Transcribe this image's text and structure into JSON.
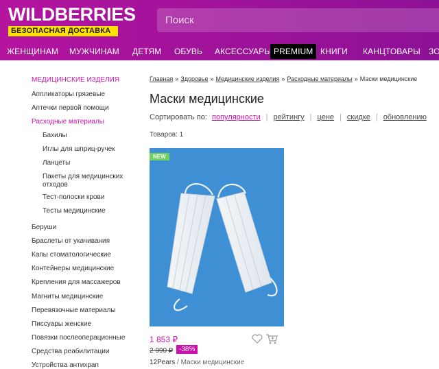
{
  "header": {
    "logo": "WILDBERRIES",
    "logo_sub": "БЕЗОПАСНАЯ ДОСТАВКА",
    "search_placeholder": "Поиск",
    "nav": [
      "ЖЕНЩИНАМ",
      "МУЖЧИНАМ",
      "ДЕТЯМ",
      "ОБУВЬ",
      "АКСЕССУАРЫ",
      "PREMIUM",
      "КНИГИ",
      "КАНЦТОВАРЫ",
      "ЗО"
    ]
  },
  "sidebar": {
    "heading": "МЕДИЦИНСКИЕ ИЗДЕЛИЯ",
    "items": [
      "Аппликаторы грязевые",
      "Аптечки первой помощи",
      "Расходные материалы",
      "Бахилы",
      "Иглы для шприц-ручек",
      "Ланцеты",
      "Пакеты для медицинских отходов",
      "Тест-полоски крови",
      "Тесты медицинские",
      "Беруши",
      "Браслеты от укачивания",
      "Капы стоматологические",
      "Контейнеры медицинские",
      "Крепления для массажеров",
      "Магниты медицинские",
      "Перевязочные материалы",
      "Писсуары женские",
      "Повязки послеоперационные",
      "Средства реабилитации",
      "Устройства антихрап"
    ]
  },
  "breadcrumbs": {
    "items": [
      "Главная",
      "Здоровье",
      "Медицинские изделия",
      "Расходные материалы"
    ],
    "current": "Маски медицинские",
    "separator": "»"
  },
  "page": {
    "title": "Маски медицинские",
    "sort_label": "Сортировать по:",
    "sort_options": [
      "популярности",
      "рейтингу",
      "цене",
      "скидке",
      "обновлению"
    ],
    "count_label": "Товаров:",
    "count_value": "1"
  },
  "product": {
    "badge": "NEW",
    "price": "1 853 ₽",
    "old_price": "2 990 ₽",
    "discount": "-38%",
    "brand": "12Pears",
    "brand_sep": " / ",
    "name": "Маски медицинские"
  },
  "colors": {
    "brand": "#cb11ab",
    "header_gradient_start": "#b4159f",
    "header_gradient_end": "#8c1196",
    "logo_sub_bg": "#ffe100",
    "badge_new": "#6fd05f",
    "product_bg": "#3e8fd3"
  },
  "icons": {
    "favorite": "heart-icon",
    "cart": "cart-icon"
  }
}
